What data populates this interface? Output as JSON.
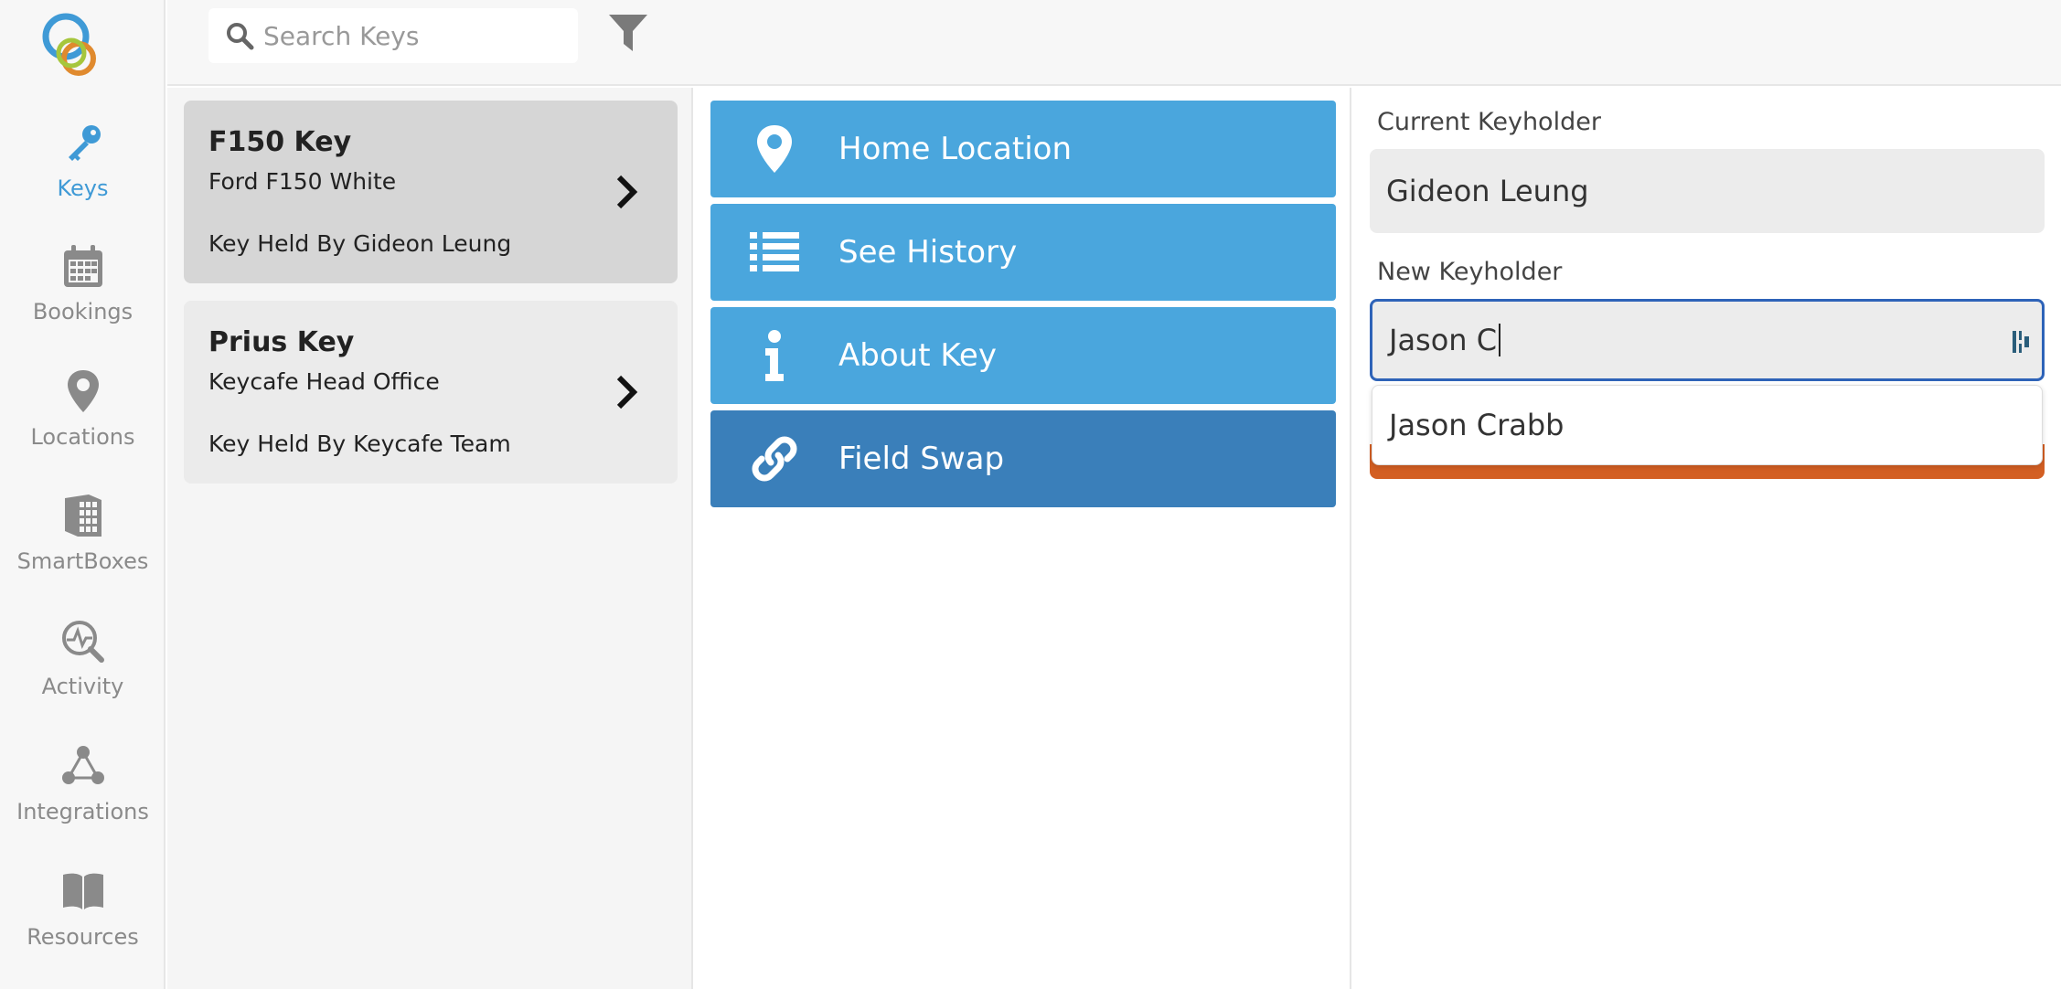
{
  "nav": {
    "items": [
      {
        "label": "Keys",
        "icon": "key-icon",
        "active": true
      },
      {
        "label": "Bookings",
        "icon": "calendar-icon"
      },
      {
        "label": "Locations",
        "icon": "map-pin-icon"
      },
      {
        "label": "SmartBoxes",
        "icon": "smartbox-icon"
      },
      {
        "label": "Activity",
        "icon": "activity-icon"
      },
      {
        "label": "Integrations",
        "icon": "integrations-icon"
      },
      {
        "label": "Resources",
        "icon": "book-icon"
      }
    ]
  },
  "search": {
    "placeholder": "Search Keys",
    "value": ""
  },
  "keys": [
    {
      "title": "F150 Key",
      "subtitle": "Ford F150 White",
      "held": "Key Held By Gideon Leung",
      "selected": true
    },
    {
      "title": "Prius Key",
      "subtitle": "Keycafe Head Office",
      "held": "Key Held By Keycafe Team"
    }
  ],
  "actions": [
    {
      "label": "Home Location",
      "icon": "map-pin-icon"
    },
    {
      "label": "See History",
      "icon": "list-icon"
    },
    {
      "label": "About Key",
      "icon": "info-icon"
    },
    {
      "label": "Field Swap",
      "icon": "link-icon"
    }
  ],
  "details": {
    "current_label": "Current Keyholder",
    "current_value": "Gideon Leung",
    "new_label": "New Keyholder",
    "new_value": "Jason C",
    "suggestion": "Jason Crabb"
  },
  "colors": {
    "accent": "#4aa6dd",
    "accent_dark": "#3a7fba",
    "nav_active": "#3f9ad6",
    "focus_border": "#2e63b8",
    "orange": "#d35f23"
  }
}
